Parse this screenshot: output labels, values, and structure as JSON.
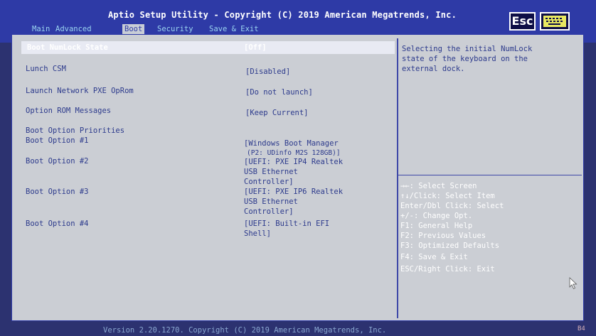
{
  "header": {
    "title": "Aptio Setup Utility - Copyright (C) 2019 American Megatrends, Inc.",
    "tabs": [
      {
        "label": "Main"
      },
      {
        "label": "Advanced"
      },
      {
        "label": "Boot"
      },
      {
        "label": "Security"
      },
      {
        "label": "Save & Exit"
      }
    ],
    "esc_label": "Esc",
    "keyboard_icon": "keyboard-icon"
  },
  "settings": [
    {
      "label": "Boot NumLock State",
      "value": "[Off]"
    },
    {
      "label": "Lunch CSM",
      "value": "[Disabled]"
    },
    {
      "label": "Launch Network PXE OpRom",
      "value": "[Do not launch]"
    },
    {
      "label": "Option ROM Messages",
      "value": "[Keep Current]"
    }
  ],
  "boot_priorities": {
    "heading": "Boot Option Priorities",
    "options": [
      {
        "label": "Boot Option #1",
        "value_lines": [
          "[Windows Boot Manager",
          "(P2: UDinfo M2S 128GB)]"
        ]
      },
      {
        "label": "Boot Option #2",
        "value_lines": [
          "[UEFI: PXE IP4 Realtek",
          "USB Ethernet",
          "Controller]"
        ]
      },
      {
        "label": "Boot Option #3",
        "value_lines": [
          "[UEFI: PXE IP6 Realtek",
          "USB Ethernet",
          "Controller]"
        ]
      },
      {
        "label": "Boot Option #4",
        "value_lines": [
          "[UEFI: Built-in EFI",
          "Shell]"
        ]
      }
    ]
  },
  "help_text": [
    "Selecting the initial NumLock",
    "state of the keyboard on the",
    "external dock."
  ],
  "key_help": [
    "→←: Select Screen",
    "↑↓/Click: Select Item",
    "Enter/Dbl Click: Select",
    "+/-: Change Opt.",
    "F1: General Help",
    "F2: Previous Values",
    "F3: Optimized Defaults",
    "F4: Save & Exit",
    "ESC/Right Click: Exit"
  ],
  "footer": {
    "text": "Version 2.20.1270. Copyright (C) 2019 American Megatrends, Inc.",
    "corner": "B4"
  },
  "colors": {
    "header_blue": "#2e3aa6",
    "panel_gray": "#cbced4",
    "text_blue": "#2c3a8c",
    "tab_text": "#9ad4f0"
  }
}
